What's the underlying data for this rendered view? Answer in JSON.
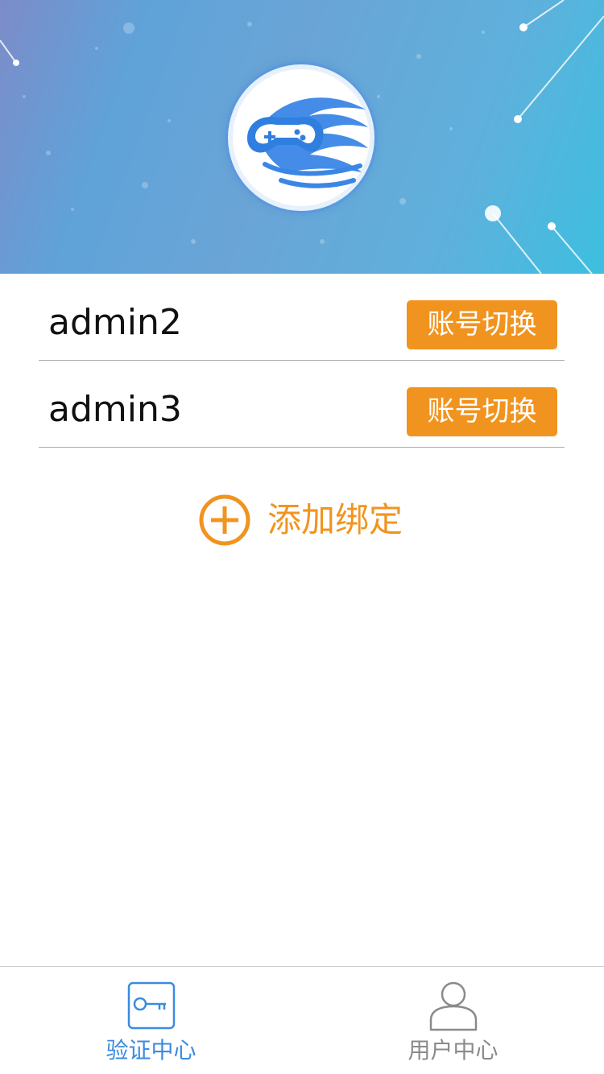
{
  "header": {
    "logo_icon": "gamepad-logo-icon",
    "colors": {
      "banner_start": "#7c8cc9",
      "banner_end": "#3dbfe0",
      "logo_blue": "#3a86e6"
    }
  },
  "accounts": [
    {
      "name": "admin2",
      "switch_label": "账号切换"
    },
    {
      "name": "admin3",
      "switch_label": "账号切换"
    }
  ],
  "add_bind": {
    "icon": "plus-circle-icon",
    "label": "添加绑定"
  },
  "tabbar": {
    "tabs": [
      {
        "label": "验证中心",
        "icon": "key-icon",
        "active": true
      },
      {
        "label": "用户中心",
        "icon": "user-icon",
        "active": false
      }
    ]
  },
  "colors": {
    "accent_orange": "#f1941f",
    "active_blue": "#3a8be0",
    "inactive_gray": "#8a8a8a"
  }
}
